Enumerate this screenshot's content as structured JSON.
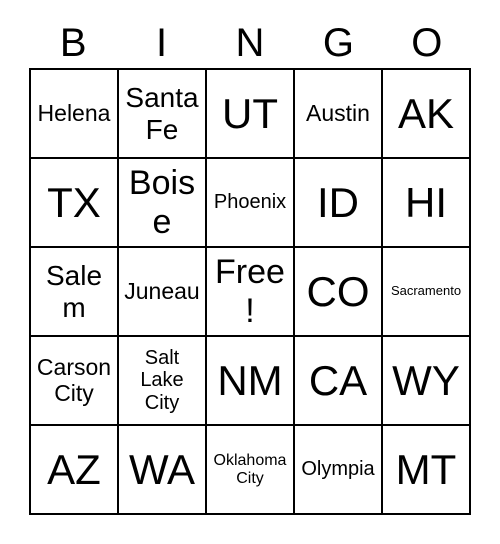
{
  "card": {
    "title": "BINGO",
    "header_letters": [
      "B",
      "I",
      "N",
      "G",
      "O"
    ],
    "free_space_label": "Free!",
    "rows": [
      [
        {
          "text": "Helena",
          "size": "md"
        },
        {
          "text": "Santa Fe",
          "size": "lg"
        },
        {
          "text": "UT",
          "size": "xxl"
        },
        {
          "text": "Austin",
          "size": "md"
        },
        {
          "text": "AK",
          "size": "xxl"
        }
      ],
      [
        {
          "text": "TX",
          "size": "xxl"
        },
        {
          "text": "Boise",
          "size": "xl"
        },
        {
          "text": "Phoenix",
          "size": "sm"
        },
        {
          "text": "ID",
          "size": "xxl"
        },
        {
          "text": "HI",
          "size": "xxl"
        }
      ],
      [
        {
          "text": "Salem",
          "size": "lg"
        },
        {
          "text": "Juneau",
          "size": "md"
        },
        {
          "text": "Free!",
          "size": "xl"
        },
        {
          "text": "CO",
          "size": "xxl"
        },
        {
          "text": "Sacramento",
          "size": "xxs"
        }
      ],
      [
        {
          "text": "Carson City",
          "size": "md"
        },
        {
          "text": "Salt Lake City",
          "size": "sm"
        },
        {
          "text": "NM",
          "size": "xxl"
        },
        {
          "text": "CA",
          "size": "xxl"
        },
        {
          "text": "WY",
          "size": "xxl"
        }
      ],
      [
        {
          "text": "AZ",
          "size": "xxl"
        },
        {
          "text": "WA",
          "size": "xxl"
        },
        {
          "text": "Oklahoma City",
          "size": "xs"
        },
        {
          "text": "Olympia",
          "size": "sm"
        },
        {
          "text": "MT",
          "size": "xxl"
        }
      ]
    ]
  },
  "colors": {
    "background": "#ffffff",
    "text": "#000000",
    "grid_line": "#000000"
  }
}
